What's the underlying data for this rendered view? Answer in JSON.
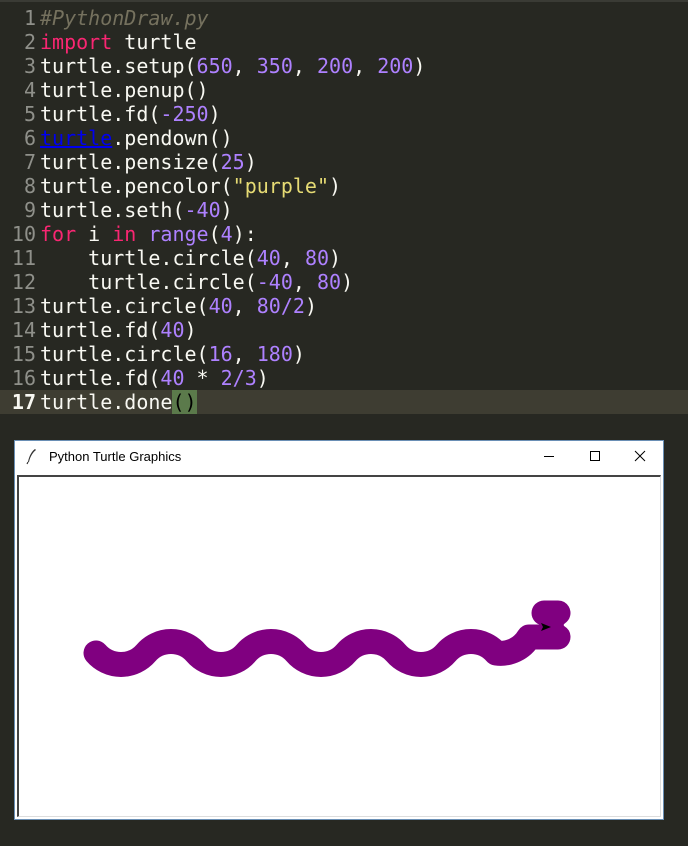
{
  "editor": {
    "lines": [
      {
        "n": "1",
        "tokens": [
          {
            "t": "#PythonDraw.py",
            "c": "comment"
          }
        ]
      },
      {
        "n": "2",
        "tokens": [
          {
            "t": "import",
            "c": "kw"
          },
          {
            "t": " turtle",
            "c": "ident"
          }
        ]
      },
      {
        "n": "3",
        "tokens": [
          {
            "t": "turtle.setup(",
            "c": "ident"
          },
          {
            "t": "650",
            "c": "num"
          },
          {
            "t": ", ",
            "c": "ident"
          },
          {
            "t": "350",
            "c": "num"
          },
          {
            "t": ", ",
            "c": "ident"
          },
          {
            "t": "200",
            "c": "num"
          },
          {
            "t": ", ",
            "c": "ident"
          },
          {
            "t": "200",
            "c": "num"
          },
          {
            "t": ")",
            "c": "ident"
          }
        ]
      },
      {
        "n": "4",
        "tokens": [
          {
            "t": "turtle.penup()",
            "c": "ident"
          }
        ]
      },
      {
        "n": "5",
        "tokens": [
          {
            "t": "turtle.fd(",
            "c": "ident"
          },
          {
            "t": "-250",
            "c": "num"
          },
          {
            "t": ")",
            "c": "ident"
          }
        ]
      },
      {
        "n": "6",
        "tokens": [
          {
            "t": "turtle",
            "c": "link"
          },
          {
            "t": ".pendown()",
            "c": "ident"
          }
        ]
      },
      {
        "n": "7",
        "tokens": [
          {
            "t": "turtle.pensize(",
            "c": "ident"
          },
          {
            "t": "25",
            "c": "num"
          },
          {
            "t": ")",
            "c": "ident"
          }
        ]
      },
      {
        "n": "8",
        "tokens": [
          {
            "t": "turtle.pencolor(",
            "c": "ident"
          },
          {
            "t": "\"purple\"",
            "c": "str"
          },
          {
            "t": ")",
            "c": "ident"
          }
        ]
      },
      {
        "n": "9",
        "tokens": [
          {
            "t": "turtle.seth(",
            "c": "ident"
          },
          {
            "t": "-40",
            "c": "num"
          },
          {
            "t": ")",
            "c": "ident"
          }
        ]
      },
      {
        "n": "10",
        "tokens": [
          {
            "t": "for",
            "c": "kw"
          },
          {
            "t": " i ",
            "c": "ident"
          },
          {
            "t": "in",
            "c": "kw"
          },
          {
            "t": " ",
            "c": "ident"
          },
          {
            "t": "range",
            "c": "builtin"
          },
          {
            "t": "(",
            "c": "ident"
          },
          {
            "t": "4",
            "c": "num"
          },
          {
            "t": "):",
            "c": "ident"
          }
        ]
      },
      {
        "n": "11",
        "tokens": [
          {
            "t": "    turtle.circle(",
            "c": "ident"
          },
          {
            "t": "40",
            "c": "num"
          },
          {
            "t": ", ",
            "c": "ident"
          },
          {
            "t": "80",
            "c": "num"
          },
          {
            "t": ")",
            "c": "ident"
          }
        ]
      },
      {
        "n": "12",
        "tokens": [
          {
            "t": "    turtle.circle(",
            "c": "ident"
          },
          {
            "t": "-40",
            "c": "num"
          },
          {
            "t": ", ",
            "c": "ident"
          },
          {
            "t": "80",
            "c": "num"
          },
          {
            "t": ")",
            "c": "ident"
          }
        ]
      },
      {
        "n": "13",
        "tokens": [
          {
            "t": "turtle.circle(",
            "c": "ident"
          },
          {
            "t": "40",
            "c": "num"
          },
          {
            "t": ", ",
            "c": "ident"
          },
          {
            "t": "80/2",
            "c": "num"
          },
          {
            "t": ")",
            "c": "ident"
          }
        ]
      },
      {
        "n": "14",
        "tokens": [
          {
            "t": "turtle.fd(",
            "c": "ident"
          },
          {
            "t": "40",
            "c": "num"
          },
          {
            "t": ")",
            "c": "ident"
          }
        ]
      },
      {
        "n": "15",
        "tokens": [
          {
            "t": "turtle.circle(",
            "c": "ident"
          },
          {
            "t": "16",
            "c": "num"
          },
          {
            "t": ", ",
            "c": "ident"
          },
          {
            "t": "180",
            "c": "num"
          },
          {
            "t": ")",
            "c": "ident"
          }
        ]
      },
      {
        "n": "16",
        "tokens": [
          {
            "t": "turtle.fd(",
            "c": "ident"
          },
          {
            "t": "40",
            "c": "num"
          },
          {
            "t": " * ",
            "c": "ident"
          },
          {
            "t": "2/3",
            "c": "num"
          },
          {
            "t": ")",
            "c": "ident"
          }
        ]
      },
      {
        "n": "17",
        "tokens": [
          {
            "t": "turtle.done",
            "c": "ident"
          },
          {
            "t": "()",
            "c": "paren-hl"
          }
        ],
        "active": true
      }
    ]
  },
  "window": {
    "title": "Python Turtle Graphics",
    "icon": "feather-icon",
    "minimize_icon": "minimize-icon",
    "maximize_icon": "maximize-icon",
    "close_icon": "close-icon"
  },
  "drawing": {
    "pen_color": "#800080",
    "background": "#ffffff"
  }
}
